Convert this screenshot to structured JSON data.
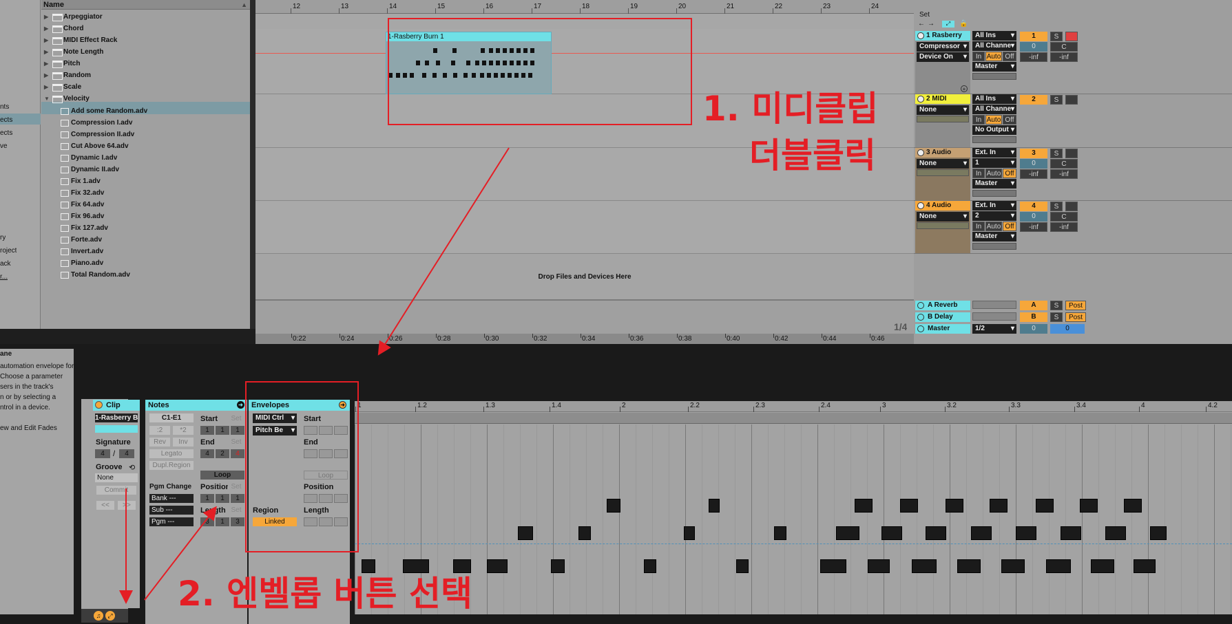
{
  "browser": {
    "name_header": "Name",
    "left_items": [
      "nts",
      "ects",
      "ects",
      "ve",
      "ry",
      "roject",
      "ack",
      "r..."
    ],
    "folders": [
      "Arpeggiator",
      "Chord",
      "MIDI Effect Rack",
      "Note Length",
      "Pitch",
      "Random",
      "Scale",
      "Velocity"
    ],
    "files": [
      "Add some Random.adv",
      "Compression I.adv",
      "Compression II.adv",
      "Cut Above 64.adv",
      "Dynamic I.adv",
      "Dynamic II.adv",
      "Fix 1.adv",
      "Fix 32.adv",
      "Fix 64.adv",
      "Fix 96.adv",
      "Fix 127.adv",
      "Forte.adv",
      "Invert.adv",
      "Piano.adv",
      "Total Random.adv"
    ]
  },
  "arrangement": {
    "bar_numbers": [
      "12",
      "13",
      "14",
      "15",
      "16",
      "17",
      "18",
      "19",
      "20",
      "21",
      "22",
      "23",
      "24"
    ],
    "time_labels": [
      "0:22",
      "0:24",
      "0:26",
      "0:28",
      "0:30",
      "0:32",
      "0:34",
      "0:36",
      "0:38",
      "0:40",
      "0:42",
      "0:44",
      "0:46"
    ],
    "clip_name": "1-Rasberry Burn 1",
    "drop_text": "Drop Files and Devices Here",
    "zoom": "1/4",
    "set_label": "Set"
  },
  "tracks": [
    {
      "name": "1 Rasberry",
      "dev1": "Compressor",
      "dev2": "Device On",
      "in": "All Ins",
      "ch": "All Channe",
      "out": "Master",
      "num": "1",
      "vol": "0",
      "pan": "C",
      "color": "#6fe0e6"
    },
    {
      "name": "2 MIDI",
      "dev1": "None",
      "dev2": "",
      "in": "All Ins",
      "ch": "All Channe",
      "out": "No Output",
      "num": "2",
      "vol": "",
      "pan": "",
      "color": "#f1ef3c"
    },
    {
      "name": "3 Audio",
      "dev1": "None",
      "dev2": "",
      "in": "Ext. In",
      "ch": "1",
      "out": "Master",
      "num": "3",
      "vol": "0",
      "pan": "C",
      "color": "#c5a073"
    },
    {
      "name": "4 Audio",
      "dev1": "None",
      "dev2": "",
      "in": "Ext. In",
      "ch": "2",
      "out": "Master",
      "num": "4",
      "vol": "0",
      "pan": "C",
      "color": "#f6a73a"
    }
  ],
  "mixer_buttons": {
    "in": "In",
    "auto": "Auto",
    "off": "Off",
    "inf": "-inf",
    "s": "S"
  },
  "returns": [
    {
      "name": "A Reverb",
      "letter": "A",
      "post": "Post"
    },
    {
      "name": "B Delay",
      "letter": "B",
      "post": "Post"
    },
    {
      "name": "Master",
      "letter": "0",
      "post": "0"
    }
  ],
  "master_sel": "1/2",
  "info": {
    "title": "ane",
    "lines": [
      "automation envelope for",
      "Choose a parameter",
      "sers in the track's",
      "n or by selecting a",
      "ntrol in a device.",
      "",
      "ew and Edit Fades"
    ]
  },
  "clip_panel": {
    "header": "Clip",
    "name": "1-Rasberry B",
    "signature": "Signature",
    "sig_num": "4",
    "sig_slash": "/",
    "sig_den": "4",
    "groove": "Groove",
    "groove_val": "None",
    "commit": "Commit",
    "left": "<<",
    "right": ">>"
  },
  "notes_panel": {
    "header": "Notes",
    "range": "C1-E1",
    "div2": ":2",
    "mul2": "*2",
    "rev": "Rev",
    "inv": "Inv",
    "legato": "Legato",
    "dupl": "Dupl.Region",
    "pgm_change": "Pgm Change",
    "bank": "Bank ---",
    "sub": "Sub ---",
    "pgm": "Pgm ---",
    "start": "Start",
    "end": "End",
    "loop": "Loop",
    "position": "Position",
    "length": "Length",
    "set": "Set",
    "start_vals": [
      "1",
      "1",
      "1"
    ],
    "end_vals": [
      "4",
      "2",
      "4"
    ],
    "pos_vals": [
      "1",
      "1",
      "1"
    ],
    "len_vals": [
      "3",
      "1",
      "3"
    ]
  },
  "env_panel": {
    "header": "Envelopes",
    "sel1": "MIDI Ctrl",
    "sel2": "Pitch Be",
    "start": "Start",
    "end": "End",
    "loop": "Loop",
    "position": "Position",
    "region": "Region",
    "linked": "Linked",
    "length": "Length"
  },
  "editor": {
    "ruler": [
      "1",
      "1.2",
      "1.3",
      "1.4",
      "2",
      "2.2",
      "2.3",
      "2.4",
      "3",
      "3.2",
      "3.3",
      "3.4",
      "4",
      "4.2"
    ]
  },
  "annotations": {
    "a1_line1": "1. 미디클립",
    "a1_line2": "더블클릭",
    "a2": "2. 엔벨롭 버튼 선택"
  },
  "colors": {
    "accent": "#6fe0e6",
    "orange": "#f6a73a",
    "annotation": "#e41e25",
    "track_bg": "#a6a6a6"
  }
}
